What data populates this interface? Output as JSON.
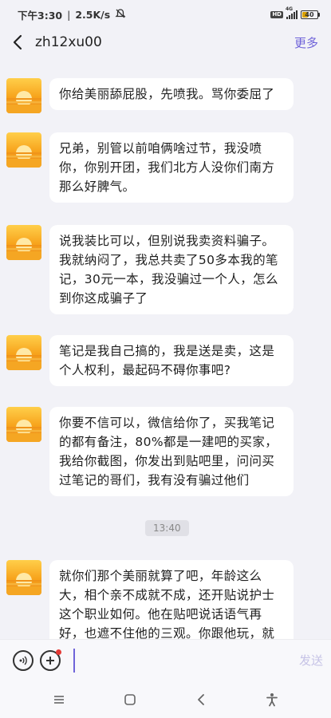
{
  "status_bar": {
    "time": "下午3:30",
    "speed": "2.5K/s",
    "network": "4G",
    "hd": "HD",
    "battery": "40"
  },
  "header": {
    "title": "zh12xu00",
    "more_label": "更多"
  },
  "messages": [
    {
      "text": "你给美丽舔屁股，先喷我。骂你委屈了"
    },
    {
      "text": "兄弟，别管以前咱俩啥过节，我没喷你，你别开团，我们北方人没你们南方那么好脾气。"
    },
    {
      "text": "说我装比可以，但别说我卖资料骗子。我就纳闷了，我总共卖了50多本我的笔记，30元一本，我没骗过一个人，怎么到你这成骗子了"
    },
    {
      "text": "笔记是我自己搞的，我是送是卖，这是个人权利，最起码不碍你事吧?"
    },
    {
      "text": "你要不信可以，微信给你了，买我笔记的都有备注，80%都是一建吧的买家，我给你截图，你发出到贴吧里，问问买过笔记的哥们，我有没有骗过他们"
    },
    {
      "text": "就你们那个美丽就算了吧，年龄这么大，相个亲不成就不成，还开贴说护士这个职业如何。他在贴吧说话语气再好，也遮不住他的三观。你跟他玩，就"
    }
  ],
  "time_divider": "13:40",
  "input": {
    "placeholder": "",
    "send_label": "发送"
  },
  "colors": {
    "accent": "#6f63d9",
    "background": "#f2f2f7",
    "bubble": "#ffffff"
  }
}
